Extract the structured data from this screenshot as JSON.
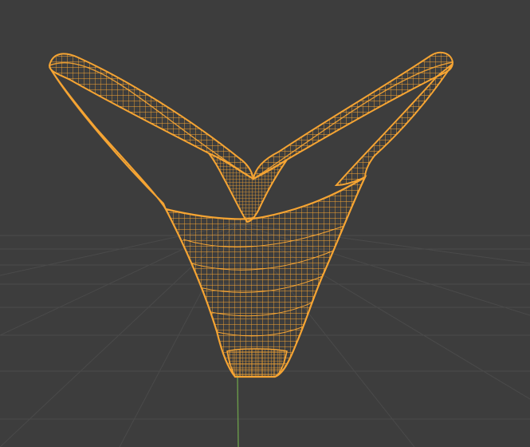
{
  "viewport": {
    "mode": "wireframe",
    "background_color": "#3d3d3d",
    "grid_color": "#4a4a4a",
    "y_axis_color": "#6a9a4a"
  },
  "object": {
    "selected": true,
    "wire_color": "#f5a433",
    "shape": "thong-garment-mesh"
  }
}
